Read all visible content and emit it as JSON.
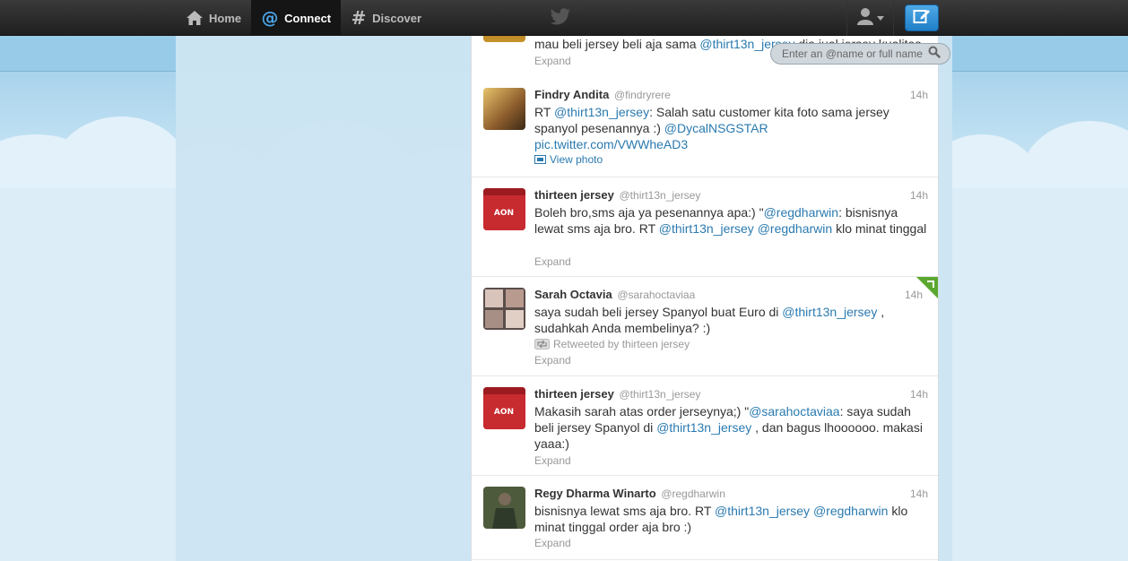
{
  "nav": {
    "home_label": "Home",
    "connect_label": "Connect",
    "discover_label": "Discover"
  },
  "search": {
    "placeholder": "Enter an @name or full name"
  },
  "colors": {
    "link": "#2a7ab0",
    "topbar": "#222222",
    "compose": "#2e8fd6",
    "retweet_flag": "#5aa82f"
  },
  "tweets": [
    {
      "text_parts": [
        "mau beli jersey beli aja sama ",
        "@thirt13n_jersey",
        " dia jual jersey kualitas"
      ],
      "action": "Expand"
    },
    {
      "name": "Findry Andita",
      "handle": "@findryrere",
      "time": "14h",
      "text_parts": [
        "RT ",
        "@thirt13n_jersey",
        ": Salah satu customer kita foto sama jersey spanyol pesenannya :) ",
        "@DycalNSGSTAR",
        "pic.twitter.com/VWWheAD3"
      ],
      "action": "View photo"
    },
    {
      "name": "thirteen jersey",
      "handle": "@thirt13n_jersey",
      "time": "14h",
      "text_parts": [
        "Boleh bro,sms aja ya pesenannya apa:) \"",
        "@regdharwin",
        ": bisnisnya lewat sms aja bro. RT ",
        "@thirt13n_jersey",
        " ",
        "@regdharwin",
        " klo minat tinggal"
      ],
      "action": "Expand"
    },
    {
      "name": "Sarah Octavia",
      "handle": "@sarahoctaviaa",
      "time": "14h",
      "text_parts": [
        "saya sudah beli jersey Spanyol buat Euro di ",
        "@thirt13n_jersey",
        " , sudahkah Anda membelinya? :)"
      ],
      "retweeted_by": "Retweeted by thirteen jersey",
      "action": "Expand"
    },
    {
      "name": "thirteen jersey",
      "handle": "@thirt13n_jersey",
      "time": "14h",
      "text_parts": [
        "Makasih sarah atas order jerseynya;) \"",
        "@sarahoctaviaa",
        ": saya sudah beli jersey Spanyol di ",
        "@thirt13n_jersey",
        " , dan bagus lhoooooo. makasi yaaa:)"
      ],
      "action": "Expand"
    },
    {
      "name": "Regy Dharma Winarto",
      "handle": "@regdharwin",
      "time": "14h",
      "text_parts": [
        "bisnisnya lewat sms aja bro. RT ",
        "@thirt13n_jersey",
        " ",
        "@regdharwin",
        " klo minat tinggal order aja bro :)"
      ],
      "action": "Expand"
    }
  ]
}
